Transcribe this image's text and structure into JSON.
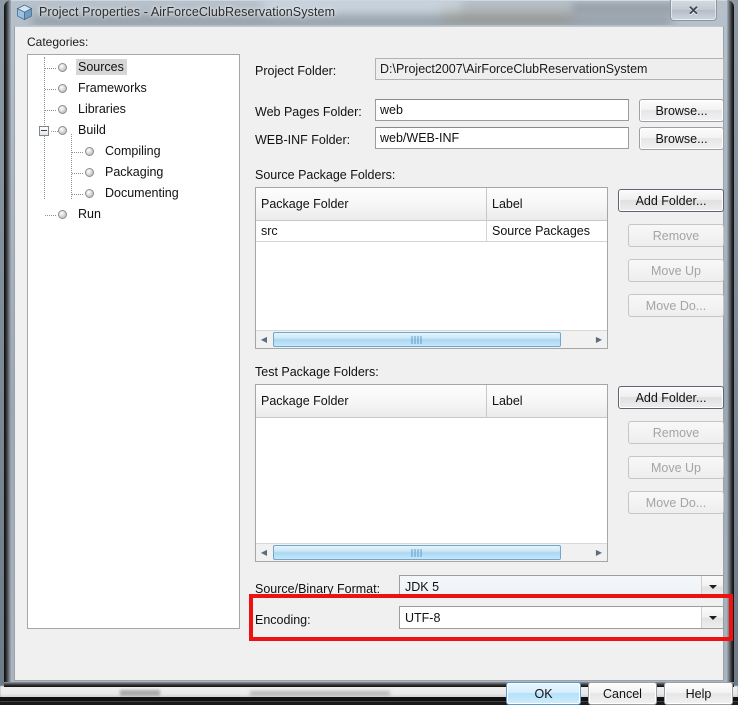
{
  "window": {
    "title": "Project Properties - AirForceClubReservationSystem",
    "icon": "project-box-icon",
    "close_glyph": "✕"
  },
  "categories": {
    "label": "Categories:",
    "items": [
      {
        "label": "Sources",
        "selected": true,
        "level": 0
      },
      {
        "label": "Frameworks",
        "selected": false,
        "level": 0
      },
      {
        "label": "Libraries",
        "selected": false,
        "level": 0
      },
      {
        "label": "Build",
        "selected": false,
        "level": 0,
        "expanded": true
      },
      {
        "label": "Compiling",
        "selected": false,
        "level": 1
      },
      {
        "label": "Packaging",
        "selected": false,
        "level": 1
      },
      {
        "label": "Documenting",
        "selected": false,
        "level": 1
      },
      {
        "label": "Run",
        "selected": false,
        "level": 0
      }
    ]
  },
  "sources_panel": {
    "project_folder": {
      "label": "Project Folder:",
      "value": "D:\\Project2007\\AirForceClubReservationSystem"
    },
    "web_pages_folder": {
      "label": "Web Pages Folder:",
      "value": "web",
      "browse_label": "Browse..."
    },
    "web_inf_folder": {
      "label": "WEB-INF Folder:",
      "value": "web/WEB-INF",
      "browse_label": "Browse..."
    },
    "source_packages": {
      "label": "Source Package Folders:",
      "columns": [
        "Package Folder",
        "Label"
      ],
      "rows": [
        {
          "folder": "src",
          "label": "Source Packages"
        }
      ],
      "buttons": [
        {
          "label": "Add Folder...",
          "enabled": true
        },
        {
          "label": "Remove",
          "enabled": false
        },
        {
          "label": "Move Up",
          "enabled": false
        },
        {
          "label": "Move Do...",
          "enabled": false
        }
      ]
    },
    "test_packages": {
      "label": "Test Package Folders:",
      "columns": [
        "Package Folder",
        "Label"
      ],
      "rows": [],
      "buttons": [
        {
          "label": "Add Folder...",
          "enabled": true
        },
        {
          "label": "Remove",
          "enabled": false
        },
        {
          "label": "Move Up",
          "enabled": false
        },
        {
          "label": "Move Do...",
          "enabled": false
        }
      ]
    },
    "source_binary_format": {
      "label": "Source/Binary Format:",
      "value": "JDK 5"
    },
    "encoding": {
      "label": "Encoding:",
      "value": "UTF-8"
    }
  },
  "annotation": {
    "color": "#ee1111",
    "target": "encoding-row"
  },
  "dialog_buttons": {
    "ok": "OK",
    "cancel": "Cancel",
    "help": "Help"
  }
}
